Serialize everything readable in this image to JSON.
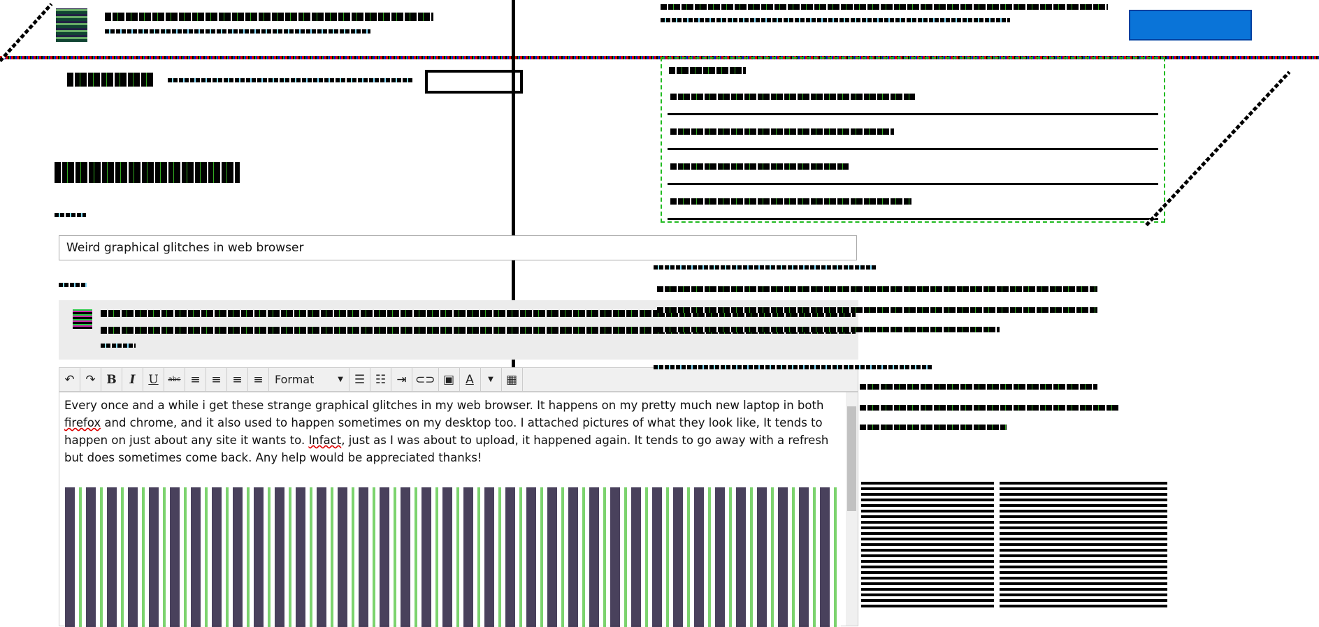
{
  "question_form": {
    "title_value": "Weird graphical glitches in web browser",
    "body_text_parts": {
      "p1": "Every once and a while i get these strange graphical glitches in my web browser. It happens on my pretty much new laptop in both ",
      "firefox": "firefox",
      "p2": " and chrome, and it also used to happen sometimes on my desktop too. I attached pictures of what they look like, It tends to happen on just about any site it wants to. ",
      "infact": "Infact",
      "p3": ", just as I was about to upload, it happened again. It tends to go away with a refresh but does sometimes come back. Any help would be appreciated thanks!"
    }
  },
  "toolbar": {
    "undo_icon": "↶",
    "redo_icon": "↷",
    "bold": "B",
    "italic": "I",
    "underline": "U",
    "strike": "abc",
    "format_label": "Format",
    "dropdown_arrow": "▼",
    "color_label": "A"
  },
  "colors": {
    "accent_button": "#0a74d8",
    "glitch_red": "#dd0000",
    "glitch_green": "#22aa22"
  }
}
